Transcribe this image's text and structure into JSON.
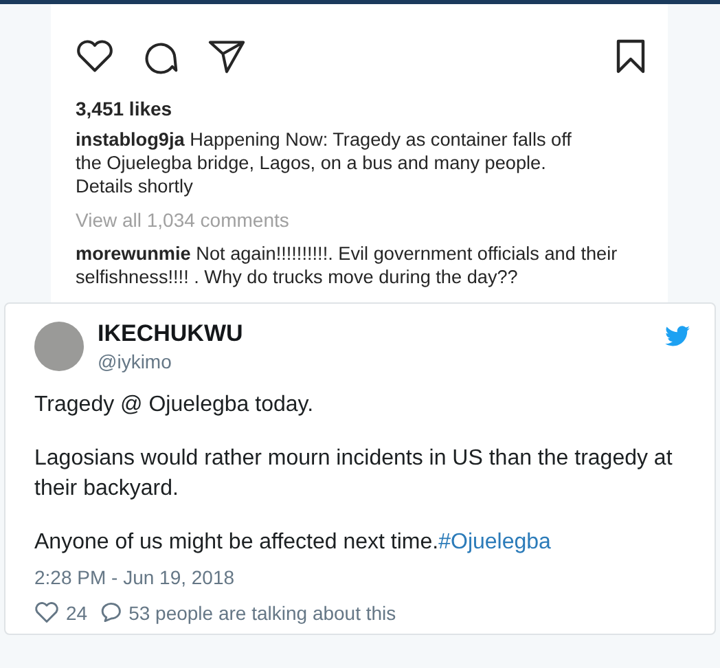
{
  "instagram_post": {
    "likes": "3,451 likes",
    "caption": {
      "username": "instablog9ja",
      "text": "Happening Now: Tragedy as container falls off the Ojuelegba bridge, Lagos, on a bus and many people. Details shortly"
    },
    "view_comments": "View all 1,034 comments",
    "comment": {
      "username": "morewunmie",
      "text": "Not again!!!!!!!!!!. Evil government officials and their selfishness!!!! . Why do trucks move during the day??"
    }
  },
  "tweet": {
    "name": "IKECHUKWU",
    "handle": "@iykimo",
    "paragraphs": [
      {
        "text": "Tragedy @ Ojuelegba today."
      },
      {
        "text": "Lagosians would rather mourn incidents in US than the tragedy at their backyard."
      },
      {
        "text": "Anyone of us might be affected next time.",
        "hashtag": "#Ojuelegba"
      }
    ],
    "timestamp": "2:28 PM - Jun 19, 2018",
    "likes": "24",
    "talking": "53 people are talking about this"
  }
}
